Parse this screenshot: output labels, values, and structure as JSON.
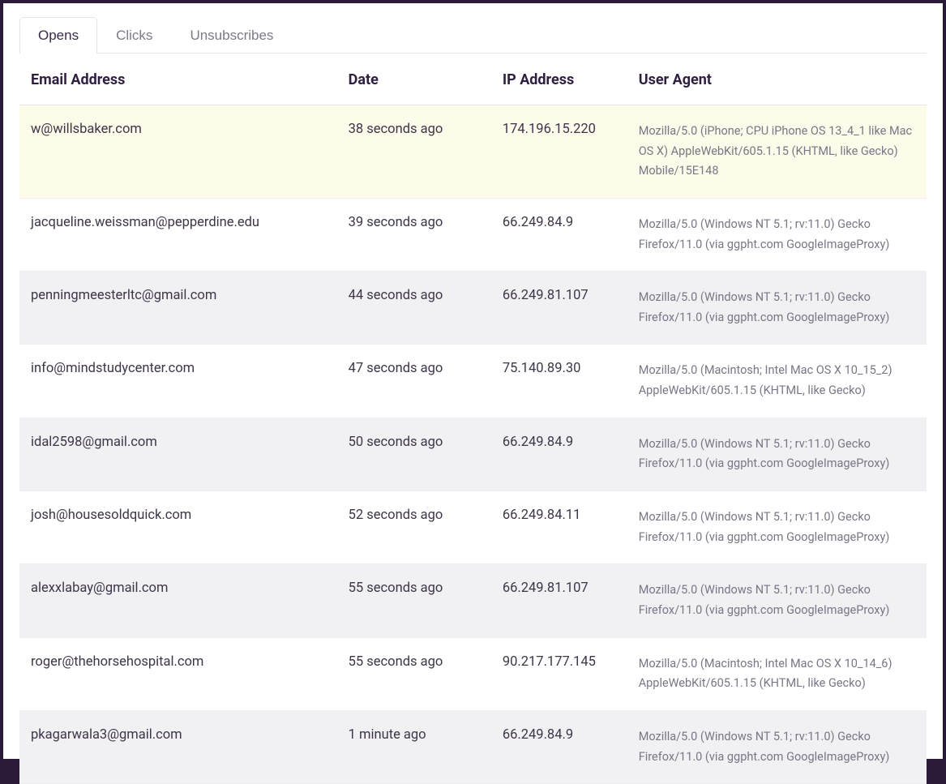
{
  "tabs": [
    {
      "label": "Opens",
      "active": true
    },
    {
      "label": "Clicks",
      "active": false
    },
    {
      "label": "Unsubscribes",
      "active": false
    }
  ],
  "columns": {
    "email": "Email Address",
    "date": "Date",
    "ip": "IP Address",
    "ua": "User Agent"
  },
  "rows": [
    {
      "email": "w@willsbaker.com",
      "date": "38 seconds ago",
      "ip": "174.196.15.220",
      "ua": "Mozilla/5.0 (iPhone; CPU iPhone OS 13_4_1 like Mac OS X) AppleWebKit/605.1.15 (KHTML, like Gecko) Mobile/15E148",
      "highlight": true
    },
    {
      "email": "jacqueline.weissman@pepperdine.edu",
      "date": "39 seconds ago",
      "ip": "66.249.84.9",
      "ua": "Mozilla/5.0 (Windows NT 5.1; rv:11.0) Gecko Firefox/11.0 (via ggpht.com GoogleImageProxy)"
    },
    {
      "email": "penningmeesterltc@gmail.com",
      "date": "44 seconds ago",
      "ip": "66.249.81.107",
      "ua": "Mozilla/5.0 (Windows NT 5.1; rv:11.0) Gecko Firefox/11.0 (via ggpht.com GoogleImageProxy)",
      "stripe": true
    },
    {
      "email": "info@mindstudycenter.com",
      "date": "47 seconds ago",
      "ip": "75.140.89.30",
      "ua": "Mozilla/5.0 (Macintosh; Intel Mac OS X 10_15_2) AppleWebKit/605.1.15 (KHTML, like Gecko)"
    },
    {
      "email": "idal2598@gmail.com",
      "date": "50 seconds ago",
      "ip": "66.249.84.9",
      "ua": "Mozilla/5.0 (Windows NT 5.1; rv:11.0) Gecko Firefox/11.0 (via ggpht.com GoogleImageProxy)",
      "stripe": true
    },
    {
      "email": "josh@housesoldquick.com",
      "date": "52 seconds ago",
      "ip": "66.249.84.11",
      "ua": "Mozilla/5.0 (Windows NT 5.1; rv:11.0) Gecko Firefox/11.0 (via ggpht.com GoogleImageProxy)"
    },
    {
      "email": "alexxlabay@gmail.com",
      "date": "55 seconds ago",
      "ip": "66.249.81.107",
      "ua": "Mozilla/5.0 (Windows NT 5.1; rv:11.0) Gecko Firefox/11.0 (via ggpht.com GoogleImageProxy)",
      "stripe": true
    },
    {
      "email": "roger@thehorsehospital.com",
      "date": "55 seconds ago",
      "ip": "90.217.177.145",
      "ua": "Mozilla/5.0 (Macintosh; Intel Mac OS X 10_14_6) AppleWebKit/605.1.15 (KHTML, like Gecko)"
    },
    {
      "email": "pkagarwala3@gmail.com",
      "date": "1 minute ago",
      "ip": "66.249.84.9",
      "ua": "Mozilla/5.0 (Windows NT 5.1; rv:11.0) Gecko Firefox/11.0 (via ggpht.com GoogleImageProxy)",
      "stripe": true
    }
  ]
}
